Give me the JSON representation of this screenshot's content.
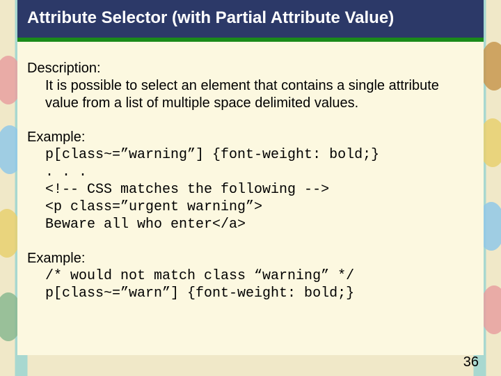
{
  "title": "Attribute Selector (with Partial Attribute Value)",
  "description": {
    "label": "Description:",
    "text": "It is possible to select an element that contains a single attribute value from a list of multiple space delimited values."
  },
  "example1": {
    "label": "Example:",
    "lines": [
      "p[class~=”warning”] {font-weight: bold;}",
      ". . .",
      "<!-- CSS matches the following -->",
      "<p class=”urgent warning”>",
      "Beware all who enter</a>"
    ]
  },
  "example2": {
    "label": "Example:",
    "lines": [
      "/* would not match class “warning” */",
      "p[class~=”warn”] {font-weight: bold;}"
    ]
  },
  "page_number": "36"
}
